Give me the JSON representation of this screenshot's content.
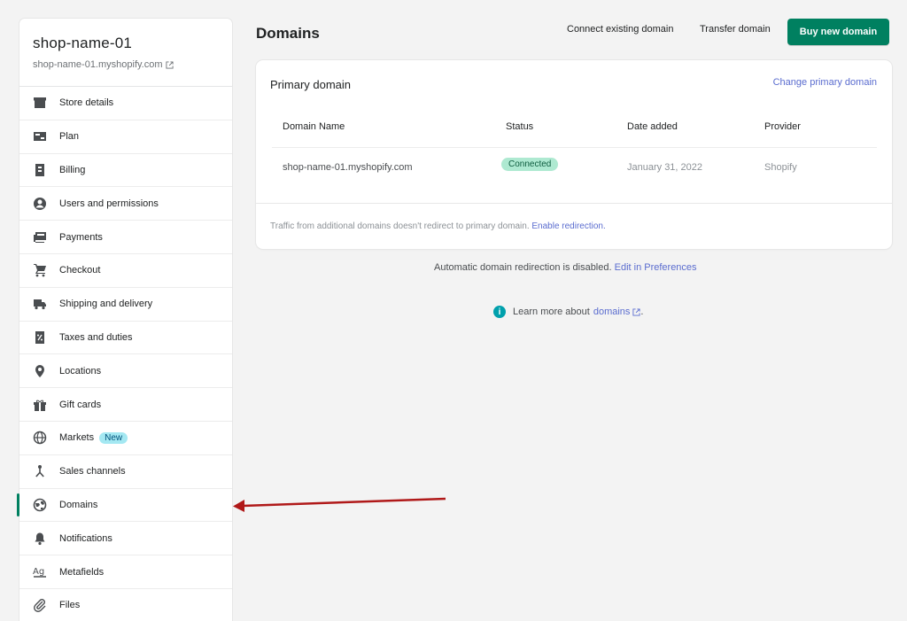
{
  "store": {
    "name": "shop-name-01",
    "url": "shop-name-01.myshopify.com"
  },
  "sidebar": {
    "items": [
      {
        "label": "Store details",
        "icon": "store-icon"
      },
      {
        "label": "Plan",
        "icon": "plan-icon"
      },
      {
        "label": "Billing",
        "icon": "billing-icon"
      },
      {
        "label": "Users and permissions",
        "icon": "user-icon"
      },
      {
        "label": "Payments",
        "icon": "payments-icon"
      },
      {
        "label": "Checkout",
        "icon": "cart-icon"
      },
      {
        "label": "Shipping and delivery",
        "icon": "truck-icon"
      },
      {
        "label": "Taxes and duties",
        "icon": "tax-icon"
      },
      {
        "label": "Locations",
        "icon": "location-icon"
      },
      {
        "label": "Gift cards",
        "icon": "gift-icon"
      },
      {
        "label": "Markets",
        "icon": "globe-icon",
        "badge": "New"
      },
      {
        "label": "Sales channels",
        "icon": "channels-icon"
      },
      {
        "label": "Domains",
        "icon": "domain-globe-icon",
        "active": true
      },
      {
        "label": "Notifications",
        "icon": "bell-icon"
      },
      {
        "label": "Metafields",
        "icon": "metafields-icon"
      },
      {
        "label": "Files",
        "icon": "paperclip-icon"
      }
    ]
  },
  "header": {
    "title": "Domains",
    "connect_label": "Connect existing domain",
    "transfer_label": "Transfer domain",
    "buy_label": "Buy new domain"
  },
  "primary_domain": {
    "title": "Primary domain",
    "change_link": "Change primary domain",
    "columns": [
      "Domain Name",
      "Status",
      "Date added",
      "Provider"
    ],
    "row": {
      "domain": "shop-name-01.myshopify.com",
      "status": "Connected",
      "date": "January 31, 2022",
      "provider": "Shopify"
    },
    "footer_text": "Traffic from additional domains doesn't redirect to primary domain.",
    "footer_link": "Enable redirection."
  },
  "redirect_note": {
    "text": "Automatic domain redirection is disabled.",
    "link": "Edit in Preferences"
  },
  "learn_more": {
    "text": "Learn more about",
    "link": "domains",
    "suffix": "."
  },
  "colors": {
    "accent": "#008060",
    "link": "#5a6ccf",
    "annotation_arrow": "#b01919"
  }
}
